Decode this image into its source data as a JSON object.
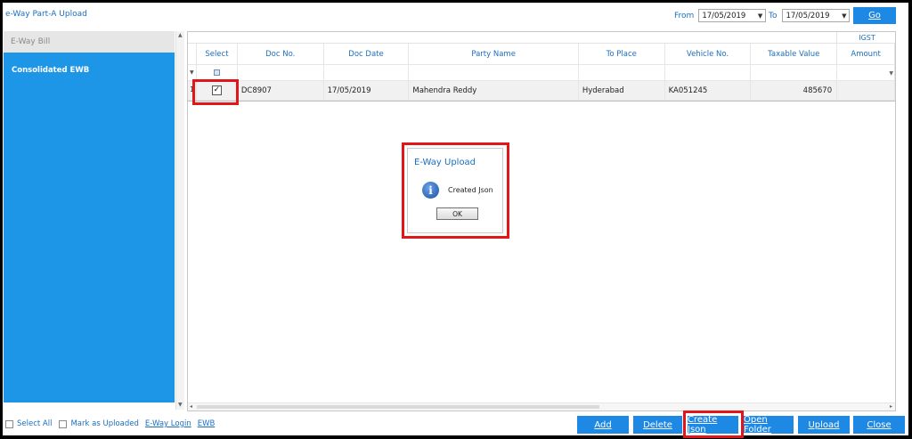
{
  "window": {
    "title": "e-Way Part-A Upload"
  },
  "date_filter": {
    "from_label": "From",
    "from_value": "17/05/2019",
    "to_label": "To",
    "to_value": "17/05/2019",
    "go_label": "Go"
  },
  "sidebar": {
    "header": "E-Way Bill",
    "items": [
      {
        "label": "Consolidated EWB"
      }
    ]
  },
  "grid": {
    "group_header": "IGST",
    "columns": [
      "Select",
      "Doc No.",
      "Doc Date",
      "Party Name",
      "To Place",
      "Vehicle No.",
      "Taxable Value",
      "Amount"
    ],
    "rows": [
      {
        "row_number": "1",
        "selected": true,
        "doc_no": "DC8907",
        "doc_date": "17/05/2019",
        "party_name": "Mahendra Reddy",
        "to_place": "Hyderabad",
        "vehicle_no": "KA051245",
        "taxable_value": "485670",
        "amount": ""
      }
    ]
  },
  "dialog": {
    "title": "E-Way Upload",
    "message": "Created Json",
    "ok_label": "OK",
    "icon": "info-icon"
  },
  "footer": {
    "select_all_label": "Select All",
    "mark_uploaded_label": "Mark as Uploaded",
    "eway_login_label": "E-Way Login",
    "ewb_label": "EWB",
    "buttons": {
      "add": "Add",
      "delete": "Delete",
      "create_json": "Create Json",
      "open_folder": "Open Folder",
      "upload": "Upload",
      "close": "Close"
    }
  },
  "colors": {
    "accent": "#1e88e5",
    "sidebar": "#1e96e8",
    "highlight": "#e0161a",
    "link": "#1b6fc2"
  }
}
